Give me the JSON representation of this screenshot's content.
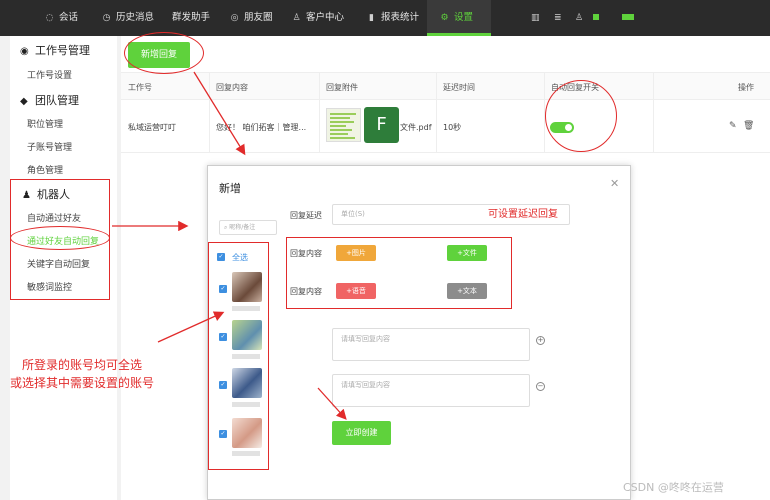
{
  "topnav": {
    "items": [
      {
        "label": "会话",
        "icon": "chat-icon"
      },
      {
        "label": "历史消息",
        "icon": "clock-icon"
      },
      {
        "label": "群发助手",
        "icon": ""
      },
      {
        "label": "朋友圈",
        "icon": "camera-icon"
      },
      {
        "label": "客户中心",
        "icon": "user-icon"
      },
      {
        "label": "报表统计",
        "icon": "bar-chart-icon"
      },
      {
        "label": "设置",
        "icon": "gear-icon"
      }
    ],
    "active": "设置",
    "accent_color": "#5fd23c"
  },
  "sidebar": {
    "groups": [
      {
        "title": "工作号管理",
        "icon": "wechat-icon",
        "items": [
          "工作号设置"
        ]
      },
      {
        "title": "团队管理",
        "icon": "team-icon",
        "items": [
          "职位管理",
          "子账号管理",
          "角色管理"
        ]
      },
      {
        "title": "机器人",
        "icon": "robot-icon",
        "items": [
          "自动通过好友",
          "通过好友自动回复",
          "关键字自动回复",
          "敏感词监控"
        ]
      }
    ],
    "active_item": "通过好友自动回复"
  },
  "main": {
    "add_button": "新增回复",
    "table": {
      "headers": [
        "工作号",
        "回复内容",
        "回复附件",
        "延迟时间",
        "自动回复开关",
        "操作"
      ],
      "row": {
        "account": "私域运营叮叮",
        "content": "您好！ 咱们拓客｜管理...",
        "attachment_letter": "F",
        "attachment_name": "文件.pdf",
        "delay": "10秒",
        "auto_reply_on": true
      }
    }
  },
  "modal": {
    "title": "新增",
    "search_placeholder": "昵称/备注",
    "select_all": "全选",
    "delay_label": "回复延迟",
    "delay_placeholder": "单位(S)",
    "content_label_1": "回复内容",
    "content_label_2": "回复内容",
    "btn_image": "+图片",
    "btn_file": "+文件",
    "btn_voice": "+语音",
    "btn_text": "+文本",
    "textarea_placeholder_1": "请填写回复内容",
    "textarea_placeholder_2": "请填写回复内容",
    "create_button": "立即创建",
    "colors": {
      "image": "#f0a73a",
      "file": "#5fd23c",
      "voice": "#f06464",
      "text": "#8c8c8c"
    }
  },
  "annotations": {
    "delay_note": "可设置延迟回复",
    "select_note_line1": "所登录的账号均可全选",
    "select_note_line2": "或选择其中需要设置的账号",
    "color": "#e12b2b"
  },
  "watermark": "CSDN @咚咚在运营"
}
